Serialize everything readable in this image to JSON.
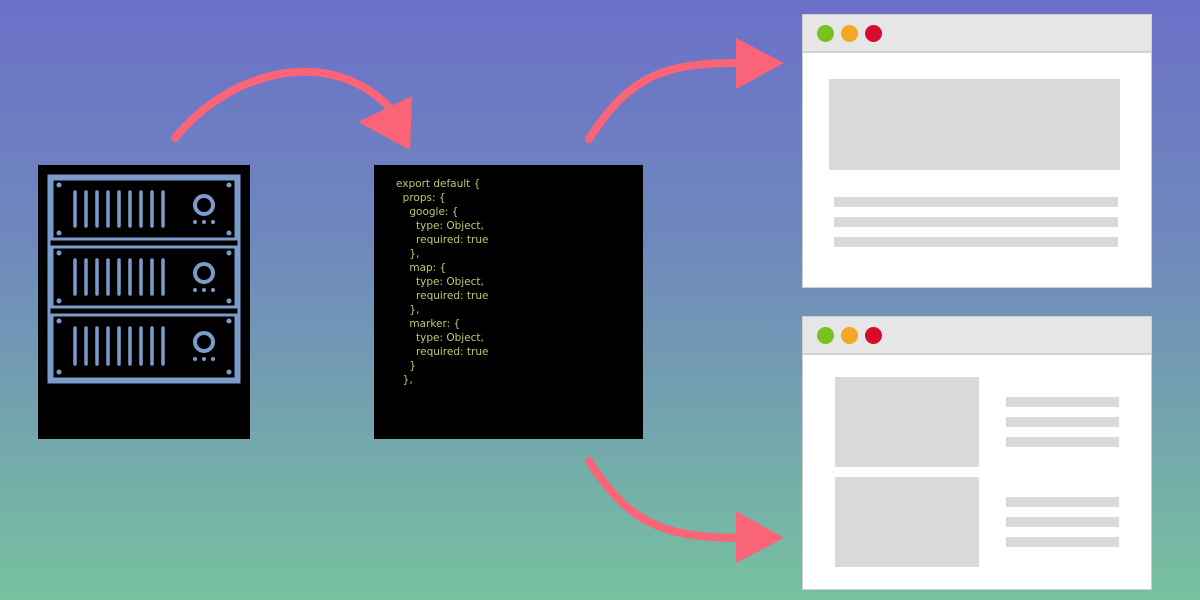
{
  "code_snippet": {
    "lines": [
      "export default {",
      "  props: {",
      "    google: {",
      "      type: Object,",
      "      required: true",
      "    },",
      "    map: {",
      "      type: Object,",
      "      required: true",
      "    },",
      "    marker: {",
      "      type: Object,",
      "      required: true",
      "    }",
      "  },"
    ]
  },
  "colors": {
    "gradient_top": "#6b70c8",
    "gradient_bottom": "#76c2a0",
    "arrow": "#fa6478",
    "server_line": "#7a9ccb",
    "code_text": "#b5cc6e",
    "window_green": "#7ac11f",
    "window_yellow": "#f3a725",
    "window_red": "#d80b2a"
  },
  "icons": {
    "server": "server-rack-icon",
    "arrow": "curved-arrow-icon"
  }
}
